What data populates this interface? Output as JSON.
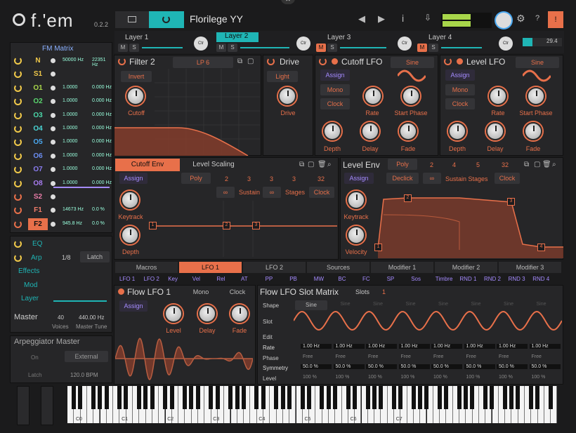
{
  "app": {
    "logo": "f.'em",
    "version": "0.2.2",
    "preset": "Florilege YY",
    "master_value": "29.4"
  },
  "icons": {
    "folder": "folder-icon",
    "power": "power-icon",
    "prev": "triangle-left-icon",
    "next": "triangle-right-icon",
    "info": "info-icon",
    "save": "save-icon",
    "gear": "gear-icon",
    "help": "help-icon",
    "alert": "alert-icon",
    "copy": "copy-icon",
    "paste": "paste-icon",
    "trash": "trash-icon",
    "search": "search-icon",
    "close": "close-icon"
  },
  "layers": [
    {
      "name": "Layer 1",
      "m": "M",
      "s": "S",
      "ctr": "Ctr"
    },
    {
      "name": "Layer 2",
      "m": "M",
      "s": "S",
      "ctr": "Ctr"
    },
    {
      "name": "Layer 3",
      "m": "M",
      "s": "S",
      "ctr": "Ctr"
    },
    {
      "name": "Layer 4",
      "m": "M",
      "s": "S",
      "ctr": "Ctr"
    }
  ],
  "fm": {
    "title": "FM Matrix",
    "rows": [
      {
        "n": "N",
        "v1": "50000 Hz",
        "v2": "22351 Hz",
        "c": "#f0c94a"
      },
      {
        "n": "S1",
        "v1": "",
        "v2": "",
        "c": "#f0c94a"
      },
      {
        "n": "O1",
        "v1": "1.0000",
        "v2": "0.000 Hz",
        "c": "#a8d64a"
      },
      {
        "n": "O2",
        "v1": "1.0000",
        "v2": "0.000 Hz",
        "c": "#5ad66e"
      },
      {
        "n": "O3",
        "v1": "1.0000",
        "v2": "0.000 Hz",
        "c": "#4ad6a8"
      },
      {
        "n": "O4",
        "v1": "1.0000",
        "v2": "0.000 Hz",
        "c": "#4ad6d6"
      },
      {
        "n": "O5",
        "v1": "1.0000",
        "v2": "0.000 Hz",
        "c": "#4aa8f0"
      },
      {
        "n": "O6",
        "v1": "1.0000",
        "v2": "0.000 Hz",
        "c": "#6a8cf0"
      },
      {
        "n": "O7",
        "v1": "1.0000",
        "v2": "0.000 Hz",
        "c": "#8a7cf0"
      },
      {
        "n": "O8",
        "v1": "1.0000",
        "v2": "0.000 Hz",
        "c": "#a87cf0"
      },
      {
        "n": "S2",
        "v1": "",
        "v2": "",
        "c": "#e87ca8"
      },
      {
        "n": "F1",
        "v1": "14673 Hz",
        "v2": "0.0 %",
        "c": "#f07c6a"
      },
      {
        "n": "F2",
        "v1": "945.8 Hz",
        "v2": "0.0 %",
        "c": "#e8704a"
      }
    ]
  },
  "side": {
    "eq": "EQ",
    "arp": "Arp",
    "arp_rate": "1/8",
    "latch": "Latch",
    "effects": "Effects",
    "mod": "Mod",
    "layer": "Layer",
    "master": "Master",
    "voices_val": "40",
    "voices": "Voices",
    "tune_val": "440.00 Hz",
    "tune": "Master Tune"
  },
  "arpm": {
    "title": "Arpeggiator Master",
    "on": "On",
    "external": "External",
    "latch": "Latch",
    "bpm": "120.0 BPM"
  },
  "filter": {
    "title": "Filter 2",
    "type": "LP 6",
    "invert": "Invert",
    "cutoff": "Cutoff"
  },
  "drive": {
    "title": "Drive",
    "light": "Light",
    "drive": "Drive"
  },
  "clfo": {
    "title": "Cutoff LFO",
    "wave": "Sine",
    "assign": "Assign",
    "mono": "Mono",
    "clock": "Clock",
    "rate": "Rate",
    "phase": "Start Phase",
    "depth": "Depth",
    "delay": "Delay",
    "fade": "Fade"
  },
  "llfo": {
    "title": "Level LFO",
    "wave": "Sine",
    "assign": "Assign",
    "mono": "Mono",
    "clock": "Clock",
    "rate": "Rate",
    "phase": "Start Phase",
    "depth": "Depth",
    "delay": "Delay",
    "fade": "Fade"
  },
  "cenv": {
    "tab1": "Cutoff Env",
    "tab2": "Level Scaling",
    "assign": "Assign",
    "poly": "Poly",
    "n2": "2",
    "n3": "3",
    "n3b": "3",
    "n32": "32",
    "sustain": "Sustain",
    "stages": "Stages",
    "clock": "Clock",
    "keytrack": "Keytrack",
    "depth": "Depth",
    "p1": "1",
    "p2": "2",
    "p3": "3"
  },
  "lenv": {
    "title": "Level Env",
    "poly": "Poly",
    "n2": "2",
    "n4": "4",
    "n5": "5",
    "n32": "32",
    "assign": "Assign",
    "declick": "Declick",
    "sustain": "Sustain Stages",
    "clock": "Clock",
    "keytrack": "Keytrack",
    "velocity": "Velocity",
    "p1": "1",
    "p2": "2",
    "p3": "3",
    "p4": "4"
  },
  "modtabs": [
    "Macros",
    "LFO 1",
    "LFO 2",
    "Sources",
    "Modifier 1",
    "Modifier 2",
    "Modifier 3"
  ],
  "sources": [
    "LFO 1",
    "LFO 2",
    "Key",
    "Vel",
    "Rel",
    "AT",
    "PP",
    "PB",
    "MW",
    "BC",
    "FC",
    "SP",
    "Sos",
    "Timbre",
    "RND 1",
    "RND 2",
    "RND 3",
    "RND 4"
  ],
  "flfo": {
    "title": "Flow LFO 1",
    "mono": "Mono",
    "clock": "Clock",
    "assign": "Assign",
    "level": "Level",
    "delay": "Delay",
    "fade": "Fade"
  },
  "slot": {
    "title": "Flow LFO Slot Matrix",
    "slots_label": "Slots",
    "slots_val": "1",
    "shape": "Shape",
    "slot": "Slot",
    "edit": "Edit",
    "rate": "Rate",
    "phase": "Phase",
    "symmetry": "Symmetry",
    "level": "Level",
    "sine": "Sine",
    "rate_val": "1.00 Hz",
    "phase_val": "Free",
    "sym_val": "50.0 %",
    "lvl_val": "100 %"
  },
  "octaves": [
    "C0",
    "C1",
    "C2",
    "C3",
    "C4",
    "C5",
    "C6",
    "C7"
  ],
  "colors": {
    "accent": "#e8704a",
    "purple": "#a58bff",
    "teal": "#1fb5b5"
  }
}
